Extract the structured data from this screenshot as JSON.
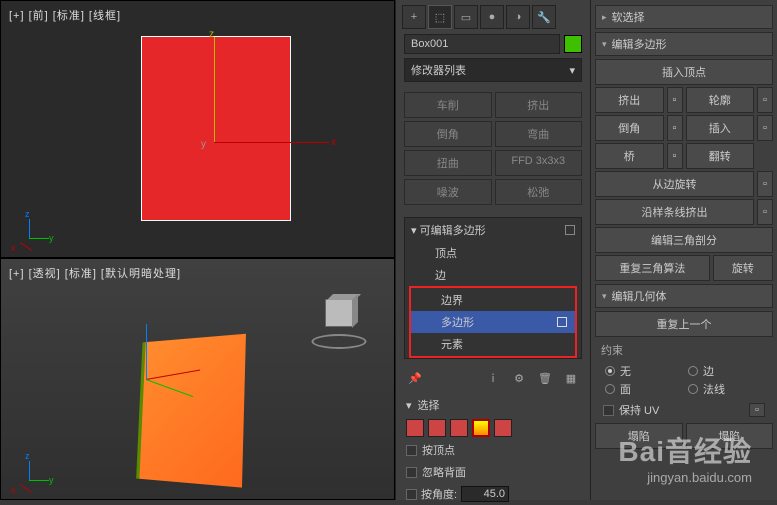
{
  "viewports": {
    "top_label": "[+] [前] [标准] [线框]",
    "bottom_label": "[+] [透视] [标准] [默认明暗处理]",
    "axis_z": "z",
    "axis_x": "x",
    "axis_y": "y"
  },
  "toolbar_icons": {
    "add": "+",
    "select": "⬚",
    "link": "▭",
    "sphere": "●",
    "sys": "◑",
    "util": "🔧"
  },
  "object_name": "Box001",
  "object_color": "#3ec000",
  "modifier_list_label": "修改器列表",
  "mod_buttons": {
    "lathe": "车削",
    "extrude": "挤出",
    "chamfer": "倒角",
    "bend": "弯曲",
    "twist": "扭曲",
    "ffd": "FFD 3x3x3",
    "noise": "噪波",
    "relax": "松弛"
  },
  "stack": {
    "header": "可编辑多边形",
    "items": [
      "顶点",
      "边",
      "边界",
      "多边形",
      "元素"
    ],
    "selected_index": 3
  },
  "icon_row": {
    "pin": "📌",
    "info": "ⅰ",
    "cfg": "⚙",
    "del": "🗑",
    "opt": "▦"
  },
  "selection": {
    "header": "选择",
    "by_vertex": "按顶点",
    "ignore_backface": "忽略背面",
    "by_angle": "按角度:",
    "angle_value": "45.0"
  },
  "right": {
    "soft_sel": "软选择",
    "edit_poly": "编辑多边形",
    "insert_vertex": "插入顶点",
    "extrude": "挤出",
    "outline": "轮廓",
    "bevel": "倒角",
    "inset": "插入",
    "bridge": "桥",
    "flip": "翻转",
    "hinge": "从边旋转",
    "extrude_spline": "沿样条线挤出",
    "edit_tri": "编辑三角剖分",
    "retri": "重复三角算法",
    "turn": "旋转",
    "edit_geom": "编辑几何体",
    "repeat_last": "重复上一个",
    "constraints": "约束",
    "none": "无",
    "edge": "边",
    "face": "面",
    "normal": "法线",
    "preserve_uv": "保持 UV",
    "create": "塌陷",
    "collapse": "塌陷"
  },
  "watermark": {
    "logo": "Bai﻿⾳经验",
    "url": "jingyan.baidu.com"
  }
}
